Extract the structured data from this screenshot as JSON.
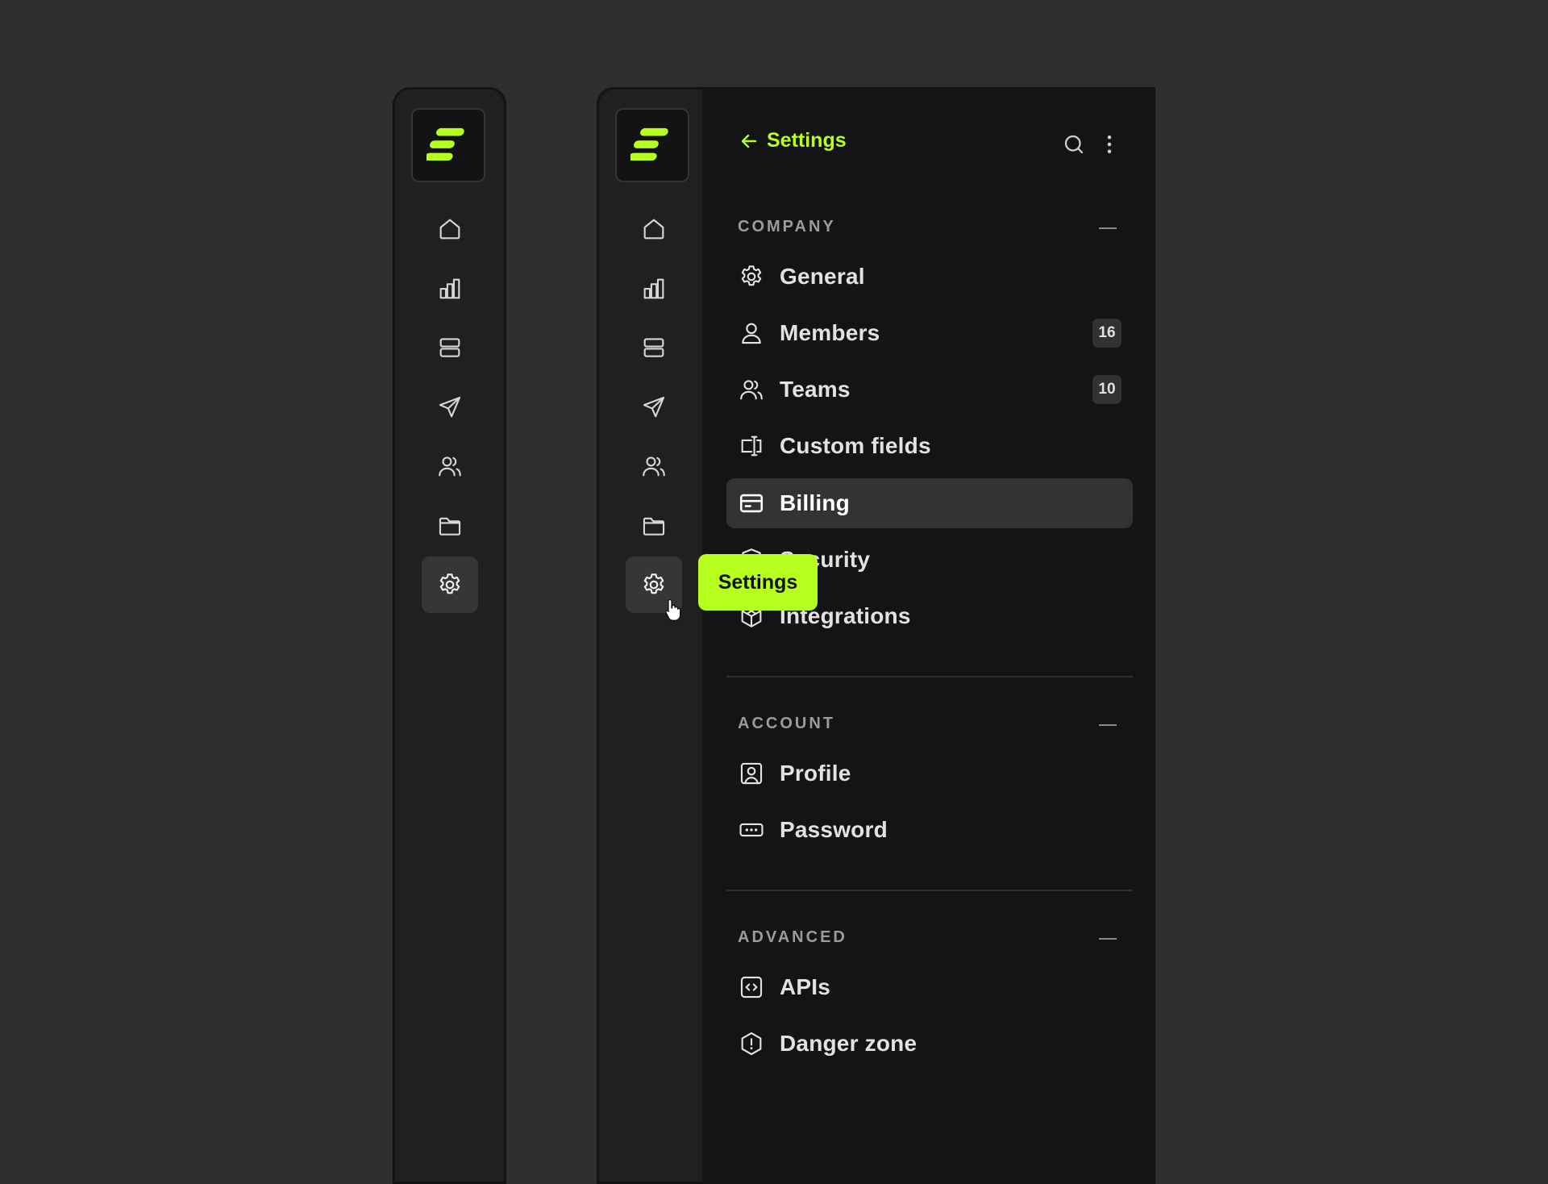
{
  "colors": {
    "accent": "#b6ff1e",
    "background": "#2e2e2e",
    "panel": "#141414",
    "rail": "#202020"
  },
  "rail_icons": [
    "home-icon",
    "bar-chart-icon",
    "server-icon",
    "send-icon",
    "users-icon",
    "folder-icon",
    "gear-icon"
  ],
  "header": {
    "back_label": "Settings",
    "icons": [
      "search-icon",
      "more-vertical-icon"
    ]
  },
  "tooltip": {
    "label": "Settings"
  },
  "sections": [
    {
      "title": "COMPANY",
      "items": [
        {
          "label": "General",
          "icon": "gear-icon"
        },
        {
          "label": "Members",
          "icon": "user-icon",
          "badge": "16"
        },
        {
          "label": "Teams",
          "icon": "users-icon",
          "badge": "10"
        },
        {
          "label": "Custom fields",
          "icon": "text-field-icon"
        },
        {
          "label": "Billing",
          "icon": "credit-card-icon",
          "active": true
        },
        {
          "label": "Security",
          "icon": "shield-icon"
        },
        {
          "label": "Integrations",
          "icon": "package-icon"
        }
      ]
    },
    {
      "title": "ACCOUNT",
      "items": [
        {
          "label": "Profile",
          "icon": "user-square-icon"
        },
        {
          "label": "Password",
          "icon": "password-icon"
        }
      ]
    },
    {
      "title": "ADVANCED",
      "items": [
        {
          "label": "APIs",
          "icon": "code-icon"
        },
        {
          "label": "Danger zone",
          "icon": "alert-octagon-icon"
        }
      ]
    }
  ]
}
